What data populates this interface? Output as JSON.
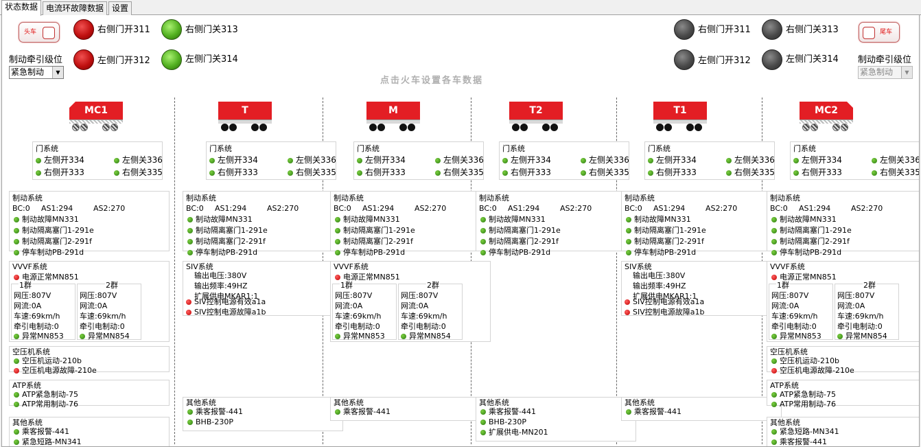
{
  "tabs": [
    "状态数据",
    "电流环故障数据",
    "设置"
  ],
  "header": {
    "head_cab_label": "头车",
    "tail_cab_label": "尾车",
    "brake_label_left": "制动牵引级位",
    "brake_label_right": "制动牵引级位",
    "left_select": "紧急制动",
    "right_select": "紧急制动",
    "hint": "点击火车设置各车数据",
    "left_lamps": [
      "右侧门开311",
      "右侧门关313",
      "左侧门开312",
      "左侧门关314"
    ],
    "right_lamps": [
      "右侧门开311",
      "右侧门关313",
      "左侧门开312",
      "左侧门关314"
    ]
  },
  "colors": {
    "lamp_red": "#c01010",
    "lamp_green": "#52b020",
    "lamp_gray": "#4a4a4a",
    "train_red": "#e31e24"
  },
  "cars": [
    {
      "name": "MC1",
      "door": {
        "title": "门系统",
        "items": [
          "左侧开334",
          "左侧关336",
          "右侧开333",
          "右侧关335"
        ]
      },
      "brake": {
        "title": "制动系统",
        "bc": "BC:0",
        "as1": "AS1:294",
        "as2": "AS2:270",
        "items": [
          "制动故障MN331",
          "制动隔离塞门1-291e",
          "制动隔离塞门2-291f",
          "停车制动PB-291d"
        ]
      },
      "power": {
        "type": "vvvf",
        "title": "VVVF系统",
        "status": "电源正常MN851",
        "g1": {
          "title": "1群",
          "v": "网压:807V",
          "i": "网流:0A",
          "s": "车速:69km/h",
          "t": "牵引电制动:0",
          "e": "异常MN853"
        },
        "g2": {
          "title": "2群",
          "v": "网压:807V",
          "i": "网流:0A",
          "s": "车速:69km/h",
          "t": "牵引电制动:0",
          "e": "异常MN854"
        }
      },
      "comp": {
        "title": "空压机系统",
        "items": [
          "空压机运动-210b",
          "空压机电源故障-210e"
        ]
      },
      "atp": {
        "title": "ATP系统",
        "items": [
          "ATP紧急制动-75",
          "ATP常用制动-76"
        ]
      },
      "other": {
        "title": "其他系统",
        "items": [
          "乘客报警-441",
          "紧急短路-MN341"
        ]
      }
    },
    {
      "name": "T",
      "door": {
        "title": "门系统",
        "items": [
          "左侧开334",
          "左侧关336",
          "右侧开333",
          "右侧关335"
        ]
      },
      "brake": {
        "title": "制动系统",
        "bc": "BC:0",
        "as1": "AS1:294",
        "as2": "AS2:270",
        "items": [
          "制动故障MN331",
          "制动隔离塞门1-291e",
          "制动隔离塞门2-291f",
          "停车制动PB-291d"
        ]
      },
      "power": {
        "type": "siv",
        "title": "SIV系统",
        "lines": [
          "输出电压:380V",
          "输出频率:49HZ",
          "扩展供电MKAR1:1"
        ],
        "items": [
          "SIV控制电源有效a1a",
          "SIV控制电源故障a1b"
        ]
      },
      "other": {
        "title": "其他系统",
        "items": [
          "乘客报警-441",
          "BHB-230P"
        ]
      }
    },
    {
      "name": "M",
      "door": {
        "title": "门系统",
        "items": [
          "左侧开334",
          "左侧关336",
          "右侧开333",
          "右侧关335"
        ]
      },
      "brake": {
        "title": "制动系统",
        "bc": "BC:0",
        "as1": "AS1:294",
        "as2": "AS2:270",
        "items": [
          "制动故障MN331",
          "制动隔离塞门1-291e",
          "制动隔离塞门2-291f",
          "停车制动PB-291d"
        ]
      },
      "power": {
        "type": "vvvf",
        "title": "VVVF系统",
        "status": "电源正常MN851",
        "g1": {
          "title": "1群",
          "v": "网压:807V",
          "i": "网流:0A",
          "s": "车速:69km/h",
          "t": "牵引电制动:0",
          "e": "异常MN853"
        },
        "g2": {
          "title": "2群",
          "v": "网压:807V",
          "i": "网流:0A",
          "s": "车速:69km/h",
          "t": "牵引电制动:0",
          "e": "异常MN854"
        }
      },
      "other": {
        "title": "其他系统",
        "items": [
          "乘客报警-441"
        ]
      }
    },
    {
      "name": "T2",
      "door": {
        "title": "门系统",
        "items": [
          "左侧开334",
          "左侧关336",
          "右侧开333",
          "右侧关335"
        ]
      },
      "brake": {
        "title": "制动系统",
        "bc": "BC:0",
        "as1": "AS1:294",
        "as2": "AS2:270",
        "items": [
          "制动故障MN331",
          "制动隔离塞门1-291e",
          "制动隔离塞门2-291f",
          "停车制动PB-291d"
        ]
      },
      "other": {
        "title": "其他系统",
        "items": [
          "乘客报警-441",
          "BHB-230P",
          "扩展供电-MN201"
        ]
      }
    },
    {
      "name": "T1",
      "door": {
        "title": "门系统",
        "items": [
          "左侧开334",
          "左侧关336",
          "右侧开333",
          "右侧关335"
        ]
      },
      "brake": {
        "title": "制动系统",
        "bc": "BC:0",
        "as1": "AS1:294",
        "as2": "AS2:270",
        "items": [
          "制动故障MN331",
          "制动隔离塞门1-291e",
          "制动隔离塞门2-291f",
          "停车制动PB-291d"
        ]
      },
      "power": {
        "type": "siv",
        "title": "SIV系统",
        "lines": [
          "输出电压:380V",
          "输出频率:49HZ",
          "扩展供电MKAR1:1"
        ],
        "items": [
          "SIV控制电源有效a1a",
          "SIV控制电源故障a1b"
        ]
      },
      "other": {
        "title": "其他系统",
        "items": [
          "乘客报警-441"
        ]
      }
    },
    {
      "name": "MC2",
      "door": {
        "title": "门系统",
        "items": [
          "左侧开334",
          "左侧关336",
          "右侧开333",
          "右侧关335"
        ]
      },
      "brake": {
        "title": "制动系统",
        "bc": "BC:0",
        "as1": "AS1:294",
        "as2": "AS2:270",
        "items": [
          "制动故障MN331",
          "制动隔离塞门1-291e",
          "制动隔离塞门2-291f",
          "停车制动PB-291d"
        ]
      },
      "power": {
        "type": "vvvf",
        "title": "VVVF系统",
        "status": "电源正常MN851",
        "g1": {
          "title": "1群",
          "v": "网压:807V",
          "i": "网流:0A",
          "s": "车速:69km/h",
          "t": "牵引电制动:0",
          "e": "异常MN853"
        },
        "g2": {
          "title": "2群",
          "v": "网压:807V",
          "i": "网流:0A",
          "s": "车速:69km/h",
          "t": "牵引电制动:0",
          "e": "异常MN854"
        }
      },
      "comp": {
        "title": "空压机系统",
        "items": [
          "空压机运动-210b",
          "空压机电源故障-210e"
        ]
      },
      "atp": {
        "title": "ATP系统",
        "items": [
          "ATP紧急制动-75",
          "ATP常用制动-76"
        ]
      },
      "other": {
        "title": "其他系统",
        "items": [
          "紧急短路-MN341",
          "乘客报警-441"
        ]
      }
    }
  ]
}
